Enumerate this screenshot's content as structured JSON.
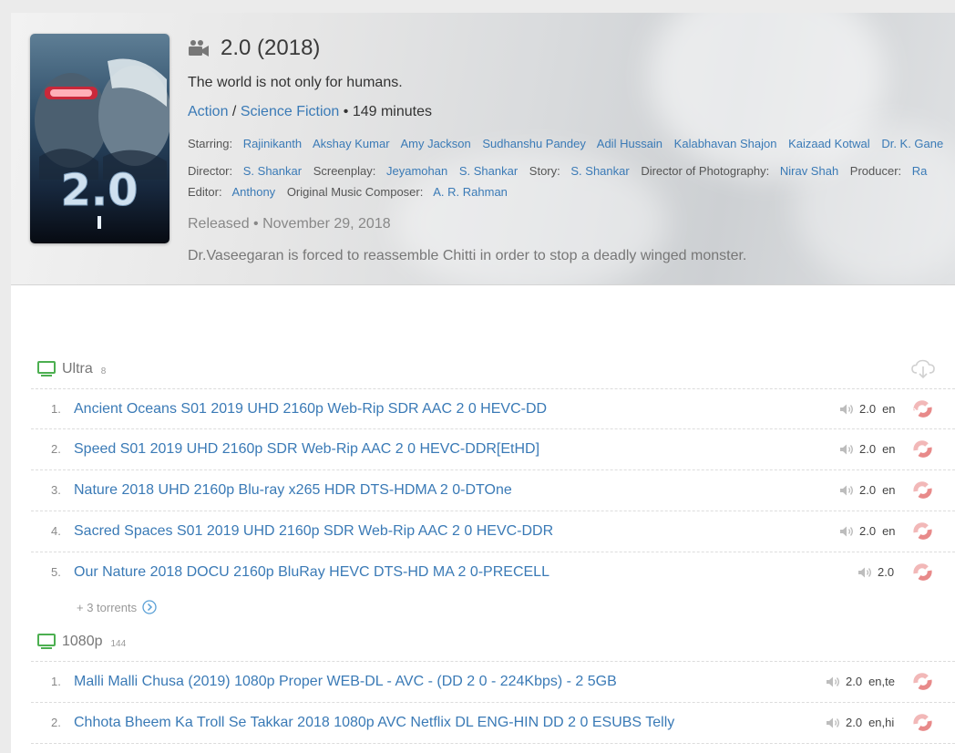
{
  "movie": {
    "title": "2.0 (2018)",
    "tagline": "The world is not only for humans.",
    "genre_1": "Action",
    "genre_sep": "/",
    "genre_2": "Science Fiction",
    "runtime": "• 149 minutes",
    "starring_label": "Starring:",
    "starring": [
      "Rajinikanth",
      "Akshay Kumar",
      "Amy Jackson",
      "Sudhanshu Pandey",
      "Adil Hussain",
      "Kalabhavan Shajon",
      "Kaizaad Kotwal",
      "Dr. K. Gane"
    ],
    "director_label": "Director:",
    "director": "S. Shankar",
    "screenplay_label": "Screenplay:",
    "screenplay": [
      "Jeyamohan",
      "S. Shankar"
    ],
    "story_label": "Story:",
    "story": "S. Shankar",
    "dop_label": "Director of Photography:",
    "dop": "Nirav Shah",
    "producer_label": "Producer:",
    "producer": "Ra",
    "editor_label": "Editor:",
    "editor": "Anthony",
    "composer_label": "Original Music Composer:",
    "composer": "A. R. Rahman",
    "released": "Released • November 29, 2018",
    "overview": "Dr.Vaseegaran is forced to reassemble Chitti in order to stop a deadly winged monster.",
    "poster_text": "2.0"
  },
  "sections": [
    {
      "title": "Ultra",
      "count": "8",
      "items": [
        {
          "num": "1.",
          "title": "Ancient Oceans S01 2019 UHD 2160p Web-Rip SDR AAC 2 0 HEVC-DD",
          "audio": "2.0",
          "lang": "en"
        },
        {
          "num": "2.",
          "title": "Speed S01 2019 UHD 2160p SDR Web-Rip AAC 2 0 HEVC-DDR[EtHD]",
          "audio": "2.0",
          "lang": "en"
        },
        {
          "num": "3.",
          "title": "Nature 2018 UHD 2160p Blu-ray x265 HDR DTS-HDMA 2 0-DTOne",
          "audio": "2.0",
          "lang": "en"
        },
        {
          "num": "4.",
          "title": "Sacred Spaces S01 2019 UHD 2160p SDR Web-Rip AAC 2 0 HEVC-DDR",
          "audio": "2.0",
          "lang": "en"
        },
        {
          "num": "5.",
          "title": "Our Nature 2018 DOCU 2160p BluRay HEVC DTS-HD MA 2 0-PRECELL",
          "audio": "2.0",
          "lang": ""
        }
      ],
      "more": "+ 3 torrents"
    },
    {
      "title": "1080p",
      "count": "144",
      "items": [
        {
          "num": "1.",
          "title": "Malli Malli Chusa (2019) 1080p Proper WEB-DL - AVC - (DD 2 0 - 224Kbps) - 2 5GB",
          "audio": "2.0",
          "lang": "en,te"
        },
        {
          "num": "2.",
          "title": "Chhota Bheem Ka Troll Se Takkar 2018 1080p AVC Netflix DL ENG-HIN DD 2 0 ESUBS Telly",
          "audio": "2.0",
          "lang": "en,hi"
        }
      ]
    }
  ],
  "colors": {
    "link": "#3a7ab6",
    "section_icon": "#4caf50",
    "magnet_icon": "#e88a8a"
  }
}
